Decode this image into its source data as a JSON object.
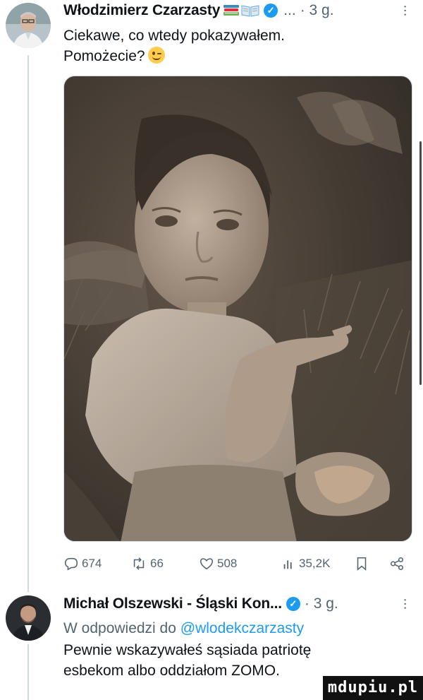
{
  "posts": [
    {
      "author": "Włodzimierz Czarzasty",
      "name_emojis": [
        "books-emoji",
        "open-book-emoji"
      ],
      "ellipsis": "...",
      "time": "· 3 g.",
      "text_line1": "Ciekawe, co wtedy pokazywałem.",
      "text_line2": "Pomożecie?",
      "actions": {
        "replies": "674",
        "reposts": "66",
        "likes": "508",
        "views": "35,2K"
      }
    },
    {
      "author": "Michał Olszewski - Śląski Kon...",
      "time": "· 3 g.",
      "reply_prefix": "W odpowiedzi do ",
      "reply_handle": "@wlodekczarzasty",
      "text_line1": "Pewnie wskazywałeś sąsiada patriotę",
      "text_line2": "esbekom albo oddziałom ZOMO."
    }
  ],
  "watermark": "mdupiu.pl",
  "colors": {
    "accent": "#1d9bf0",
    "text": "#0f1419",
    "secondary": "#536471",
    "divider": "#cfd9de"
  }
}
